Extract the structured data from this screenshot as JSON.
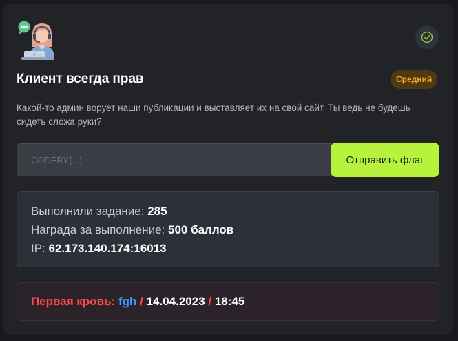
{
  "task": {
    "title": "Клиент всегда прав",
    "difficulty": "Средний",
    "description": "Какой-то админ ворует наши публикации и выставляет их на свой сайт. Ты ведь не будешь сидеть сложа руки?"
  },
  "flag_form": {
    "placeholder": "CODEBY{...}",
    "value": "",
    "submit_label": "Отправить флаг"
  },
  "stats": {
    "solved_label": "Выполнили задание: ",
    "solved_value": "285",
    "reward_label": "Награда за выполнение: ",
    "reward_value": "500 баллов",
    "ip_label": "IP: ",
    "ip_value": "62.173.140.174:16013"
  },
  "first_blood": {
    "label": "Первая кровь: ",
    "user": "fgh",
    "separator": " / ",
    "date": "14.04.2023",
    "time": "18:45"
  },
  "icons": {
    "avatar": "support-agent-avatar",
    "status": "check-circle-icon"
  },
  "colors": {
    "accent": "#b7f33d",
    "badge_text": "#f2a31c",
    "first_blood": "#ff4a4a",
    "user_link": "#3d9bff"
  }
}
